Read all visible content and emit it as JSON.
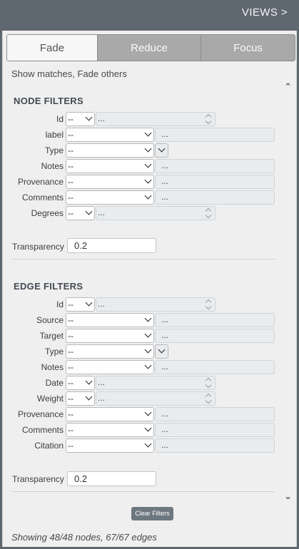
{
  "views_button": "VIEWS >",
  "tabs": [
    {
      "label": "Fade",
      "active": true
    },
    {
      "label": "Reduce",
      "active": false
    },
    {
      "label": "Focus",
      "active": false
    }
  ],
  "hint": "Show matches, Fade others",
  "node_filters": {
    "title": "NODE FILTERS",
    "rows": [
      {
        "label": "Id",
        "kind": "numeric",
        "select": "--",
        "value": "..."
      },
      {
        "label": "label",
        "kind": "text",
        "select": "--",
        "value": "..."
      },
      {
        "label": "Type",
        "kind": "type",
        "select": "--"
      },
      {
        "label": "Notes",
        "kind": "text",
        "select": "--",
        "value": "..."
      },
      {
        "label": "Provenance",
        "kind": "text",
        "select": "--",
        "value": "..."
      },
      {
        "label": "Comments",
        "kind": "text",
        "select": "--",
        "value": "..."
      },
      {
        "label": "Degrees",
        "kind": "numeric",
        "select": "--",
        "value": "..."
      }
    ],
    "transparency_label": "Transparency",
    "transparency_value": "0.2"
  },
  "edge_filters": {
    "title": "EDGE FILTERS",
    "rows": [
      {
        "label": "Id",
        "kind": "numeric",
        "select": "--",
        "value": "..."
      },
      {
        "label": "Source",
        "kind": "text",
        "select": "--",
        "value": "..."
      },
      {
        "label": "Target",
        "kind": "text",
        "select": "--",
        "value": "..."
      },
      {
        "label": "Type",
        "kind": "type",
        "select": "--"
      },
      {
        "label": "Notes",
        "kind": "text",
        "select": "--",
        "value": "..."
      },
      {
        "label": "Date",
        "kind": "numeric",
        "select": "--",
        "value": "..."
      },
      {
        "label": "Weight",
        "kind": "numeric",
        "select": "--",
        "value": "..."
      },
      {
        "label": "Provenance",
        "kind": "text",
        "select": "--",
        "value": "..."
      },
      {
        "label": "Comments",
        "kind": "text",
        "select": "--",
        "value": "..."
      },
      {
        "label": "Citation",
        "kind": "text",
        "select": "--",
        "value": "..."
      }
    ],
    "transparency_label": "Transparency",
    "transparency_value": "0.2"
  },
  "clear_button": "Clear Filters",
  "status": "Showing 48/48 nodes, 67/67 edges"
}
